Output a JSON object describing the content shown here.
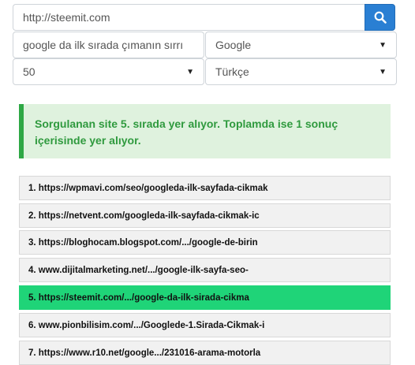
{
  "form": {
    "url_value": "http://steemit.com",
    "keyword_value": "google da ilk sırada çımanın sırrı",
    "engine_selected": "Google",
    "count_selected": "50",
    "language_selected": "Türkçe",
    "search_icon": "search-icon",
    "accent_color": "#2a7fd3"
  },
  "alert": {
    "message": "Sorgulanan site 5. sırada yer alıyor. Toplamda ise 1 sonuç içerisinde yer alıyor.",
    "color": "#2f9a3e"
  },
  "results": [
    "1. https://wpmavi.com/seo/googleda-ilk-sayfada-cikmak",
    "2. https://netvent.com/googleda-ilk-sayfada-cikmak-ic",
    "3. https://bloghocam.blogspot.com/.../google-de-birin",
    "4. www.dijitalmarketing.net/.../google-ilk-sayfa-seo-",
    "5. https://steemit.com/.../google-da-ilk-sirada-cikma",
    "6. www.pionbilisim.com/.../Googlede-1.Sirada-Cikmak-i",
    "7. https://www.r10.net/google.../231016-arama-motorla"
  ],
  "highlight_color": "#1fd478"
}
